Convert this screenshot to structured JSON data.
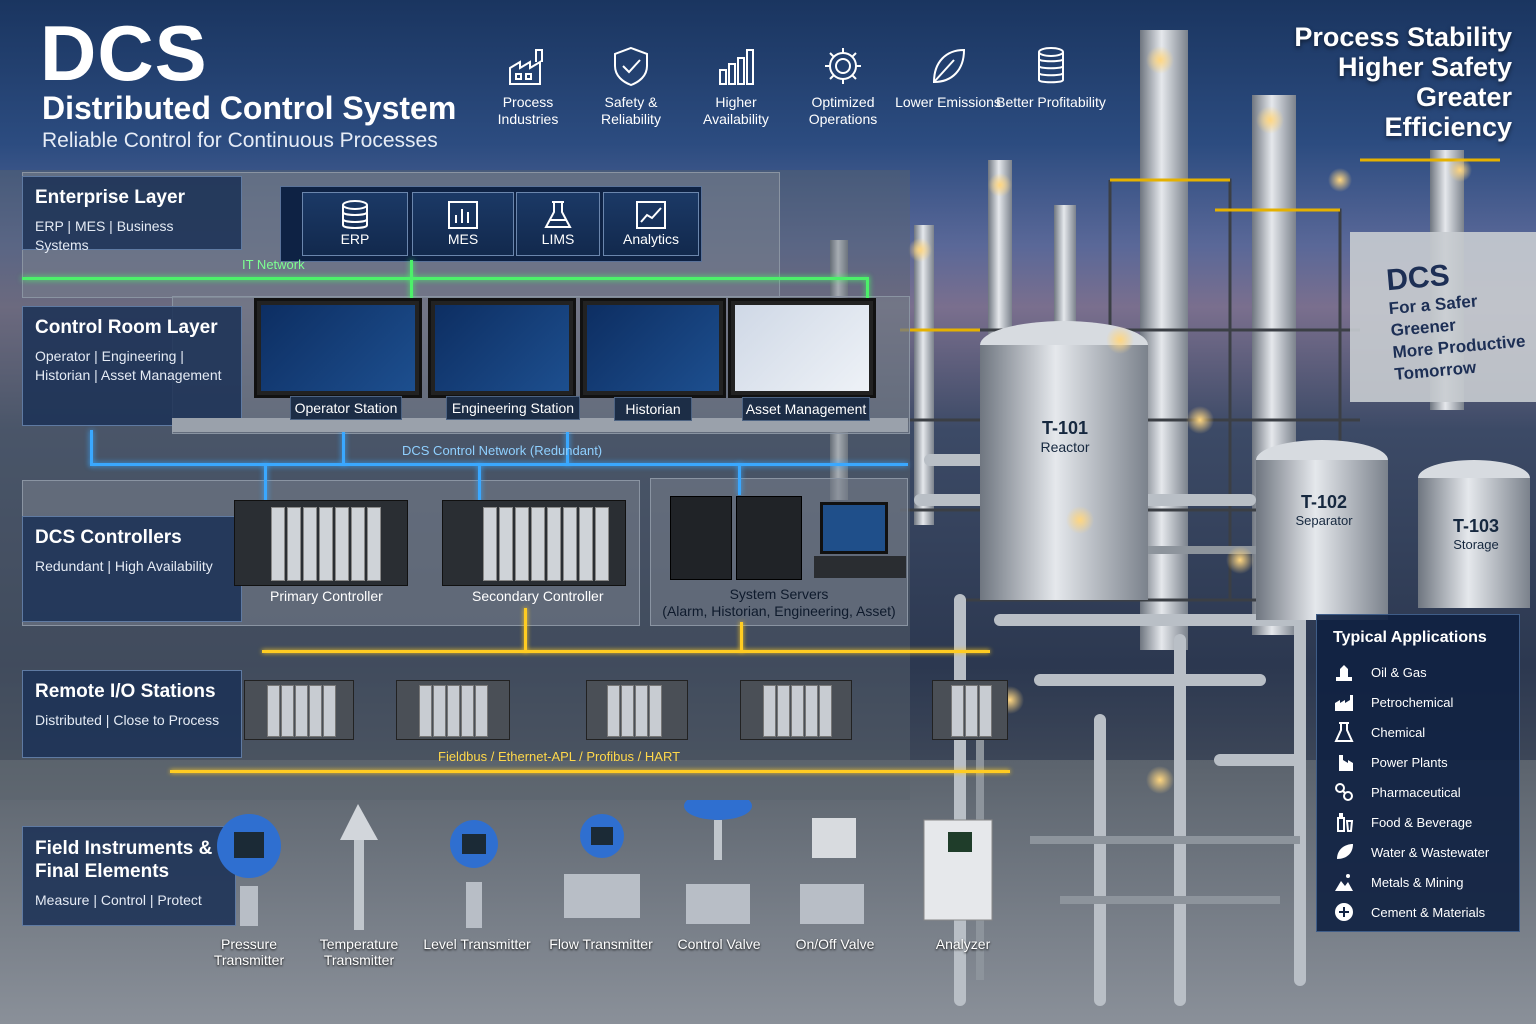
{
  "header": {
    "title": "DCS",
    "subtitle": "Distributed Control System",
    "tagline": "Reliable Control for Continuous Processes"
  },
  "benefits": [
    {
      "label": "Process Industries",
      "icon": "factory-icon"
    },
    {
      "label": "Safety & Reliability",
      "icon": "shield-check-icon"
    },
    {
      "label": "Higher Availability",
      "icon": "bar-chart-icon"
    },
    {
      "label": "Optimized Operations",
      "icon": "gear-icon"
    },
    {
      "label": "Lower Emissions",
      "icon": "leaf-icon"
    },
    {
      "label": "Better Profitability",
      "icon": "coins-stack-icon"
    }
  ],
  "top_right": [
    "Process Stability",
    "Higher Safety",
    "Greater Efficiency"
  ],
  "wall_sign": {
    "title": "DCS",
    "lines": [
      "For a Safer",
      "Greener",
      "More Productive",
      "Tomorrow"
    ]
  },
  "layers": {
    "enterprise": {
      "title": "Enterprise Layer",
      "desc": "ERP | MES | Business Systems"
    },
    "control_room": {
      "title": "Control Room Layer",
      "desc": "Operator | Engineering | Historian | Asset Management"
    },
    "controllers": {
      "title": "DCS Controllers",
      "desc": "Redundant | High Availability"
    },
    "remote_io": {
      "title": "Remote I/O Stations",
      "desc": "Distributed | Close to Process"
    },
    "field": {
      "title": "Field Instruments & Final Elements",
      "desc": "Measure | Control | Protect"
    }
  },
  "enterprise_systems": [
    {
      "label": "ERP",
      "icon": "database-icon"
    },
    {
      "label": "MES",
      "icon": "bar-chart-icon"
    },
    {
      "label": "LIMS",
      "icon": "flask-icon"
    },
    {
      "label": "Analytics",
      "icon": "trend-chart-icon"
    }
  ],
  "networks": {
    "it": "IT Network",
    "control": "DCS Control Network (Redundant)",
    "fieldbus": "Fieldbus / Ethernet-APL / Profibus / HART"
  },
  "stations": [
    "Operator Station",
    "Engineering Station",
    "Historian",
    "Asset Management"
  ],
  "controllers": [
    "Primary Controller",
    "Secondary Controller"
  ],
  "servers": {
    "title": "System Servers",
    "subtitle": "(Alarm, Historian, Engineering, Asset)"
  },
  "field_devices": [
    {
      "label": "Pressure Transmitter",
      "icon": "pressure-transmitter-icon"
    },
    {
      "label": "Temperature Transmitter",
      "icon": "temperature-transmitter-icon"
    },
    {
      "label": "Level Transmitter",
      "icon": "level-transmitter-icon"
    },
    {
      "label": "Flow Transmitter",
      "icon": "flow-transmitter-icon"
    },
    {
      "label": "Control Valve",
      "icon": "control-valve-icon"
    },
    {
      "label": "On/Off Valve",
      "icon": "on-off-valve-icon"
    },
    {
      "label": "Analyzer",
      "icon": "analyzer-icon"
    }
  ],
  "tanks": [
    {
      "id": "T-101",
      "name": "Reactor"
    },
    {
      "id": "T-102",
      "name": "Separator"
    },
    {
      "id": "T-103",
      "name": "Storage"
    }
  ],
  "applications": {
    "title": "Typical Applications",
    "items": [
      {
        "label": "Oil & Gas",
        "icon": "oil-gas-icon"
      },
      {
        "label": "Petrochemical",
        "icon": "petrochemical-icon"
      },
      {
        "label": "Chemical",
        "icon": "flask-icon"
      },
      {
        "label": "Power Plants",
        "icon": "power-plant-icon"
      },
      {
        "label": "Pharmaceutical",
        "icon": "pharmaceutical-icon"
      },
      {
        "label": "Food & Beverage",
        "icon": "food-beverage-icon"
      },
      {
        "label": "Water & Wastewater",
        "icon": "water-drop-icon"
      },
      {
        "label": "Metals & Mining",
        "icon": "mining-icon"
      },
      {
        "label": "Cement & Materials",
        "icon": "cement-icon"
      }
    ]
  },
  "colors": {
    "it_network": "#4cf06a",
    "control_network": "#3aa8ff",
    "fieldbus": "#ffcc22",
    "panel": "#1c3256",
    "device_blue": "#2f6fd0"
  }
}
